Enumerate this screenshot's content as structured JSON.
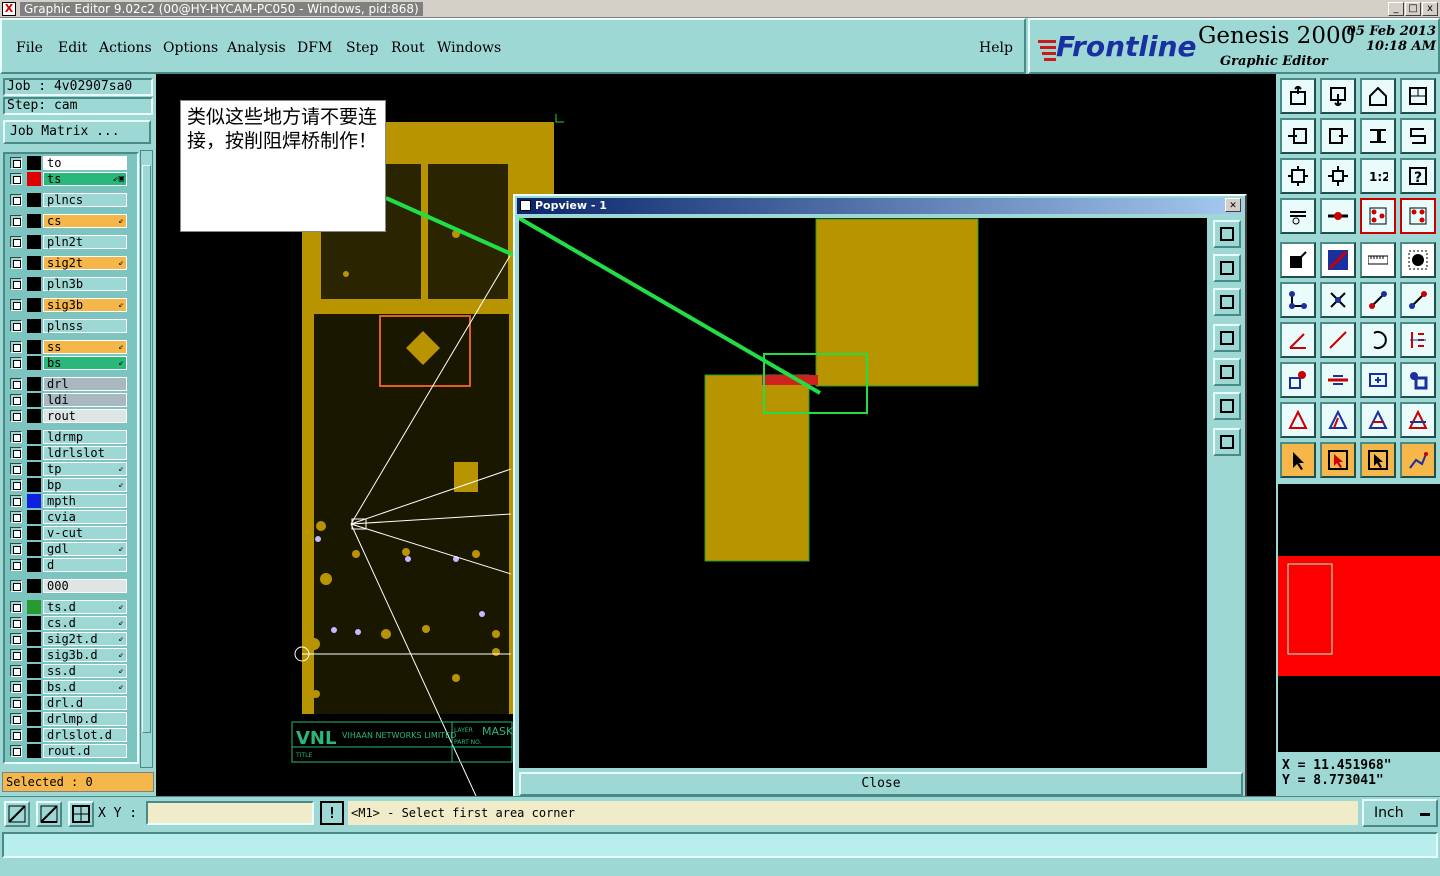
{
  "window": {
    "title": "Graphic Editor 9.02c2 (00@HY-HYCAM-PC050 - Windows, pid:868)",
    "controls": [
      "_",
      "□",
      "x"
    ]
  },
  "menu": {
    "items": [
      "File",
      "Edit",
      "Actions",
      "Options",
      "Analysis",
      "DFM",
      "Step",
      "Rout",
      "Windows"
    ],
    "help": "Help"
  },
  "brand": {
    "logo": "Frontline",
    "product": "Genesis 2000",
    "subtitle": "Graphic Editor",
    "date": "05 Feb 2013",
    "time": "10:18 AM"
  },
  "job": {
    "job_label": "Job : 4v02907sa0",
    "step_label": "Step: cam",
    "matrix_button": "Job Matrix ..."
  },
  "layers": [
    {
      "name": "to",
      "color": "#ffffff",
      "swatch": "",
      "mark": "",
      "group": 0
    },
    {
      "name": "ts",
      "color": "#2ab87a",
      "swatch": "#e00000",
      "mark": "⇙▣",
      "group": 0
    },
    {
      "name": "plncs",
      "color": "#9ed8d4",
      "swatch": "",
      "mark": "",
      "group": 1
    },
    {
      "name": "cs",
      "color": "#f5b74a",
      "swatch": "",
      "mark": "⇙",
      "group": 2
    },
    {
      "name": "pln2t",
      "color": "#9ed8d4",
      "swatch": "",
      "mark": "",
      "group": 3
    },
    {
      "name": "sig2t",
      "color": "#f5b74a",
      "swatch": "",
      "mark": "⇙",
      "group": 4
    },
    {
      "name": "pln3b",
      "color": "#9ed8d4",
      "swatch": "",
      "mark": "",
      "group": 5
    },
    {
      "name": "sig3b",
      "color": "#f5b74a",
      "swatch": "",
      "mark": "⇙",
      "group": 6
    },
    {
      "name": "plnss",
      "color": "#9ed8d4",
      "swatch": "",
      "mark": "",
      "group": 7
    },
    {
      "name": "ss",
      "color": "#f5b74a",
      "swatch": "",
      "mark": "⇙",
      "group": 8
    },
    {
      "name": "bs",
      "color": "#2ab87a",
      "swatch": "",
      "mark": "⇙",
      "group": 8
    },
    {
      "name": "drl",
      "color": "#a9b8c0",
      "swatch": "",
      "mark": "",
      "group": 9
    },
    {
      "name": "ldi",
      "color": "#a9b8c0",
      "swatch": "",
      "mark": "",
      "group": 9
    },
    {
      "name": "rout",
      "color": "#dfe4e4",
      "swatch": "",
      "mark": "",
      "group": 9
    },
    {
      "name": "ldrmp",
      "color": "#9ed8d4",
      "swatch": "",
      "mark": "",
      "group": 10
    },
    {
      "name": "ldrlslot",
      "color": "#9ed8d4",
      "swatch": "",
      "mark": "",
      "group": 10
    },
    {
      "name": "tp",
      "color": "#9ed8d4",
      "swatch": "",
      "mark": "⇙",
      "group": 10
    },
    {
      "name": "bp",
      "color": "#9ed8d4",
      "swatch": "",
      "mark": "⇙",
      "group": 10
    },
    {
      "name": "mpth",
      "color": "#9ed8d4",
      "swatch": "#1020e0",
      "mark": "",
      "group": 10
    },
    {
      "name": "cvia",
      "color": "#9ed8d4",
      "swatch": "",
      "mark": "",
      "group": 10
    },
    {
      "name": "v-cut",
      "color": "#9ed8d4",
      "swatch": "",
      "mark": "",
      "group": 10
    },
    {
      "name": "gdl",
      "color": "#9ed8d4",
      "swatch": "",
      "mark": "⇙",
      "group": 10
    },
    {
      "name": "d",
      "color": "#9ed8d4",
      "swatch": "",
      "mark": "",
      "group": 10
    },
    {
      "name": "000",
      "color": "#dfe4e4",
      "swatch": "",
      "mark": "",
      "group": 11
    },
    {
      "name": "ts.d",
      "color": "#9ed8d4",
      "swatch": "#2a9a30",
      "mark": "⇙",
      "group": 12
    },
    {
      "name": "cs.d",
      "color": "#9ed8d4",
      "swatch": "",
      "mark": "⇙",
      "group": 12
    },
    {
      "name": "sig2t.d",
      "color": "#9ed8d4",
      "swatch": "",
      "mark": "⇙",
      "group": 12
    },
    {
      "name": "sig3b.d",
      "color": "#9ed8d4",
      "swatch": "",
      "mark": "⇙",
      "group": 12
    },
    {
      "name": "ss.d",
      "color": "#9ed8d4",
      "swatch": "",
      "mark": "⇙",
      "group": 12
    },
    {
      "name": "bs.d",
      "color": "#9ed8d4",
      "swatch": "",
      "mark": "⇙",
      "group": 12
    },
    {
      "name": "drl.d",
      "color": "#9ed8d4",
      "swatch": "",
      "mark": "",
      "group": 12
    },
    {
      "name": "drlmp.d",
      "color": "#9ed8d4",
      "swatch": "",
      "mark": "",
      "group": 12
    },
    {
      "name": "drlslot.d",
      "color": "#9ed8d4",
      "swatch": "",
      "mark": "",
      "group": 12
    },
    {
      "name": "rout.d",
      "color": "#9ed8d4",
      "swatch": "",
      "mark": "",
      "group": 12
    }
  ],
  "selected_label": "Selected : 0",
  "annotation_note": "类似这些地方请不要连接，按削阻焊桥制作！",
  "title_block": {
    "company": "VIHAAN NETWORKS LIMITED",
    "layer_label": "LAYER",
    "layer_value": "MASK",
    "part_label": "PART NO.",
    "title_label": "TITLE"
  },
  "popview": {
    "title": "Popview - 1",
    "close_label": "Close"
  },
  "coords": {
    "x": "X  =  11.451968\"",
    "y": "Y  =  8.773041\""
  },
  "statusbar": {
    "xy_label": "X Y :",
    "xy_value": "",
    "warn": "!",
    "prompt": "<M1> - Select first area corner",
    "unit": "Inch"
  },
  "colors": {
    "panel": "#9ed8d4",
    "copper": "#b89400",
    "highlight_green": "#22dd44",
    "layer_orange": "#f5b74a"
  }
}
